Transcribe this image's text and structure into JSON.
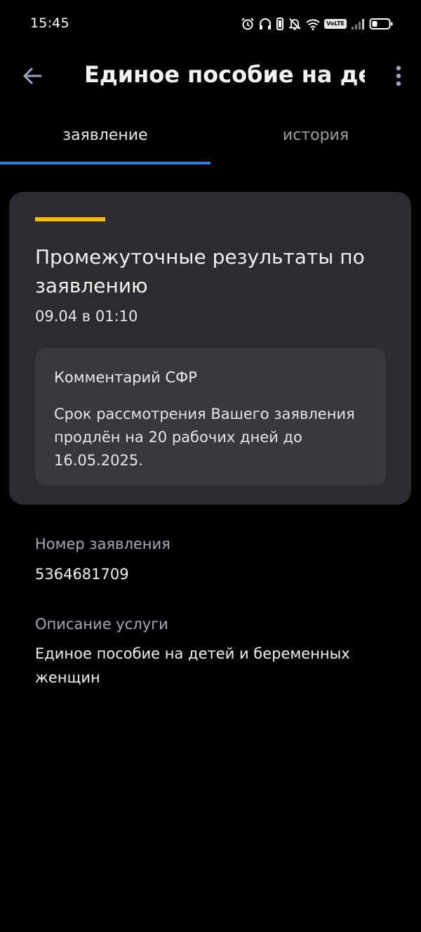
{
  "status_bar": {
    "time": "15:45",
    "volte": "VoLTE",
    "icons": [
      "alarm-icon",
      "headphones-icon",
      "vibrate-icon",
      "mute-icon",
      "wifi-icon",
      "volte-badge",
      "signal-icon",
      "battery-icon"
    ]
  },
  "app_bar": {
    "title": "Единое пособие на де...",
    "back_icon": "arrow-left-icon",
    "more_icon": "more-vertical-icon"
  },
  "tabs": [
    {
      "label": "заявление",
      "active": true
    },
    {
      "label": "история",
      "active": false
    }
  ],
  "result_card": {
    "title": "Промежуточные результаты по заявлению",
    "date": "09.04 в 01:10",
    "comment": {
      "title": "Комментарий СФР",
      "text": "Срок рассмотрения Вашего заявления продлён на 20 рабочих дней до 16.05.2025."
    }
  },
  "fields": {
    "application_number": {
      "label": "Номер заявления",
      "value": "5364681709"
    },
    "service_description": {
      "label": "Описание услуги",
      "value": "Единое пособие на детей и беременных женщин"
    }
  },
  "colors": {
    "background": "#000000",
    "card": "#2b2b30",
    "comment_box": "#38383e",
    "accent_yellow": "#f5c000",
    "tab_indicator": "#2f7fe0",
    "label_gray": "#a7a9b8"
  }
}
